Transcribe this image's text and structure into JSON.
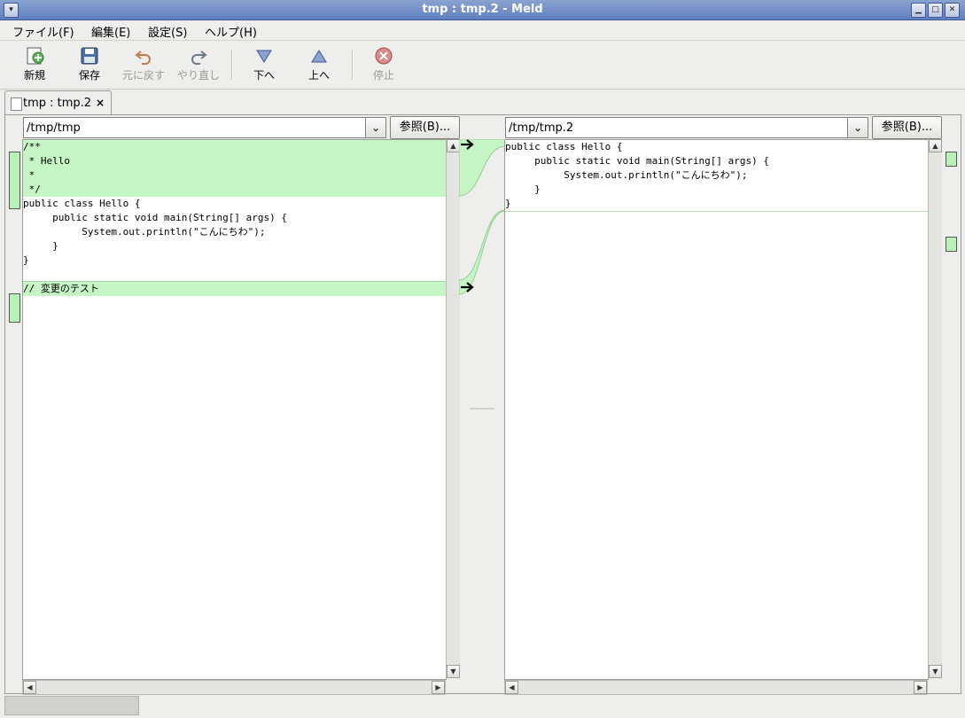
{
  "window": {
    "title": "tmp : tmp.2 - Meld"
  },
  "menu": [
    {
      "label": "ファイル(F)"
    },
    {
      "label": "編集(E)"
    },
    {
      "label": "設定(S)"
    },
    {
      "label": "ヘルプ(H)"
    }
  ],
  "toolbar": {
    "new_label": "新規",
    "save_label": "保存",
    "undo_label": "元に戻す",
    "redo_label": "やり直し",
    "down_label": "下へ",
    "up_label": "上へ",
    "stop_label": "停止"
  },
  "tab": {
    "label": "tmp : tmp.2",
    "close": "×"
  },
  "left": {
    "path": "/tmp/tmp",
    "browse_label": "参照(B)...",
    "lines": [
      "/**",
      " * Hello",
      " *",
      " */",
      "public class Hello {",
      "     public static void main(String[] args) {",
      "          System.out.println(\"こんにちわ\");",
      "     }",
      "}",
      "",
      "// 変更のテスト"
    ]
  },
  "right": {
    "path": "/tmp/tmp.2",
    "browse_label": "参照(B)...",
    "lines": [
      "public class Hello {",
      "     public static void main(String[] args) {",
      "          System.out.println(\"こんにちわ\");",
      "     }",
      "}"
    ]
  },
  "colors": {
    "change": "#c6f5c6",
    "titlebar": "#6f8cc6"
  }
}
